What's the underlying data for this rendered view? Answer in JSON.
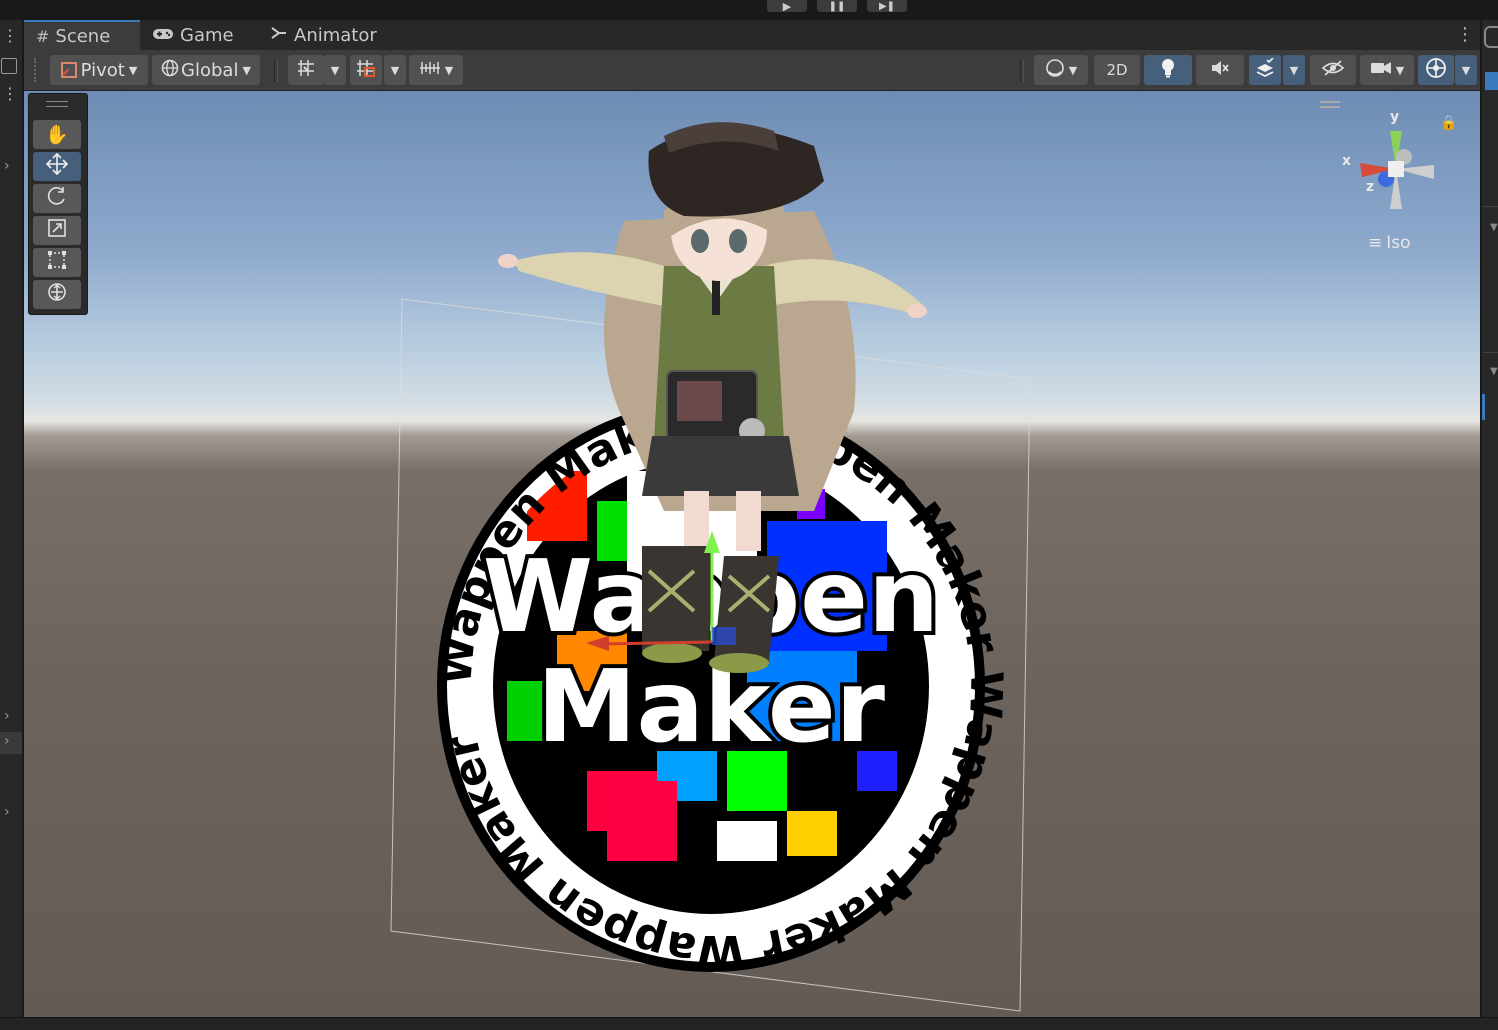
{
  "tabs": [
    {
      "label": "Scene",
      "icon": "grid-hash-icon"
    },
    {
      "label": "Game",
      "icon": "gamepad-icon"
    },
    {
      "label": "Animator",
      "icon": "animator-icon"
    }
  ],
  "toolbar": {
    "pivot_label": "Pivot",
    "global_label": "Global",
    "mode_2d_label": "2D"
  },
  "gizmo": {
    "y_label": "y",
    "x_label": "x",
    "z_label": "z",
    "projection_label": "Iso"
  },
  "scene": {
    "patch_top_text": "Wappen Maker",
    "patch_line1": "Wappen",
    "patch_line2": "Maker",
    "patch_ring_text": "Wappen Maker Wappen Maker Wappen Maker Wappen Maker"
  },
  "colors": {
    "tab_accent": "#3a79bb",
    "selected_tool": "#46607c",
    "panel_bg": "#282828",
    "toolbar_bg": "#3c3c3c"
  }
}
